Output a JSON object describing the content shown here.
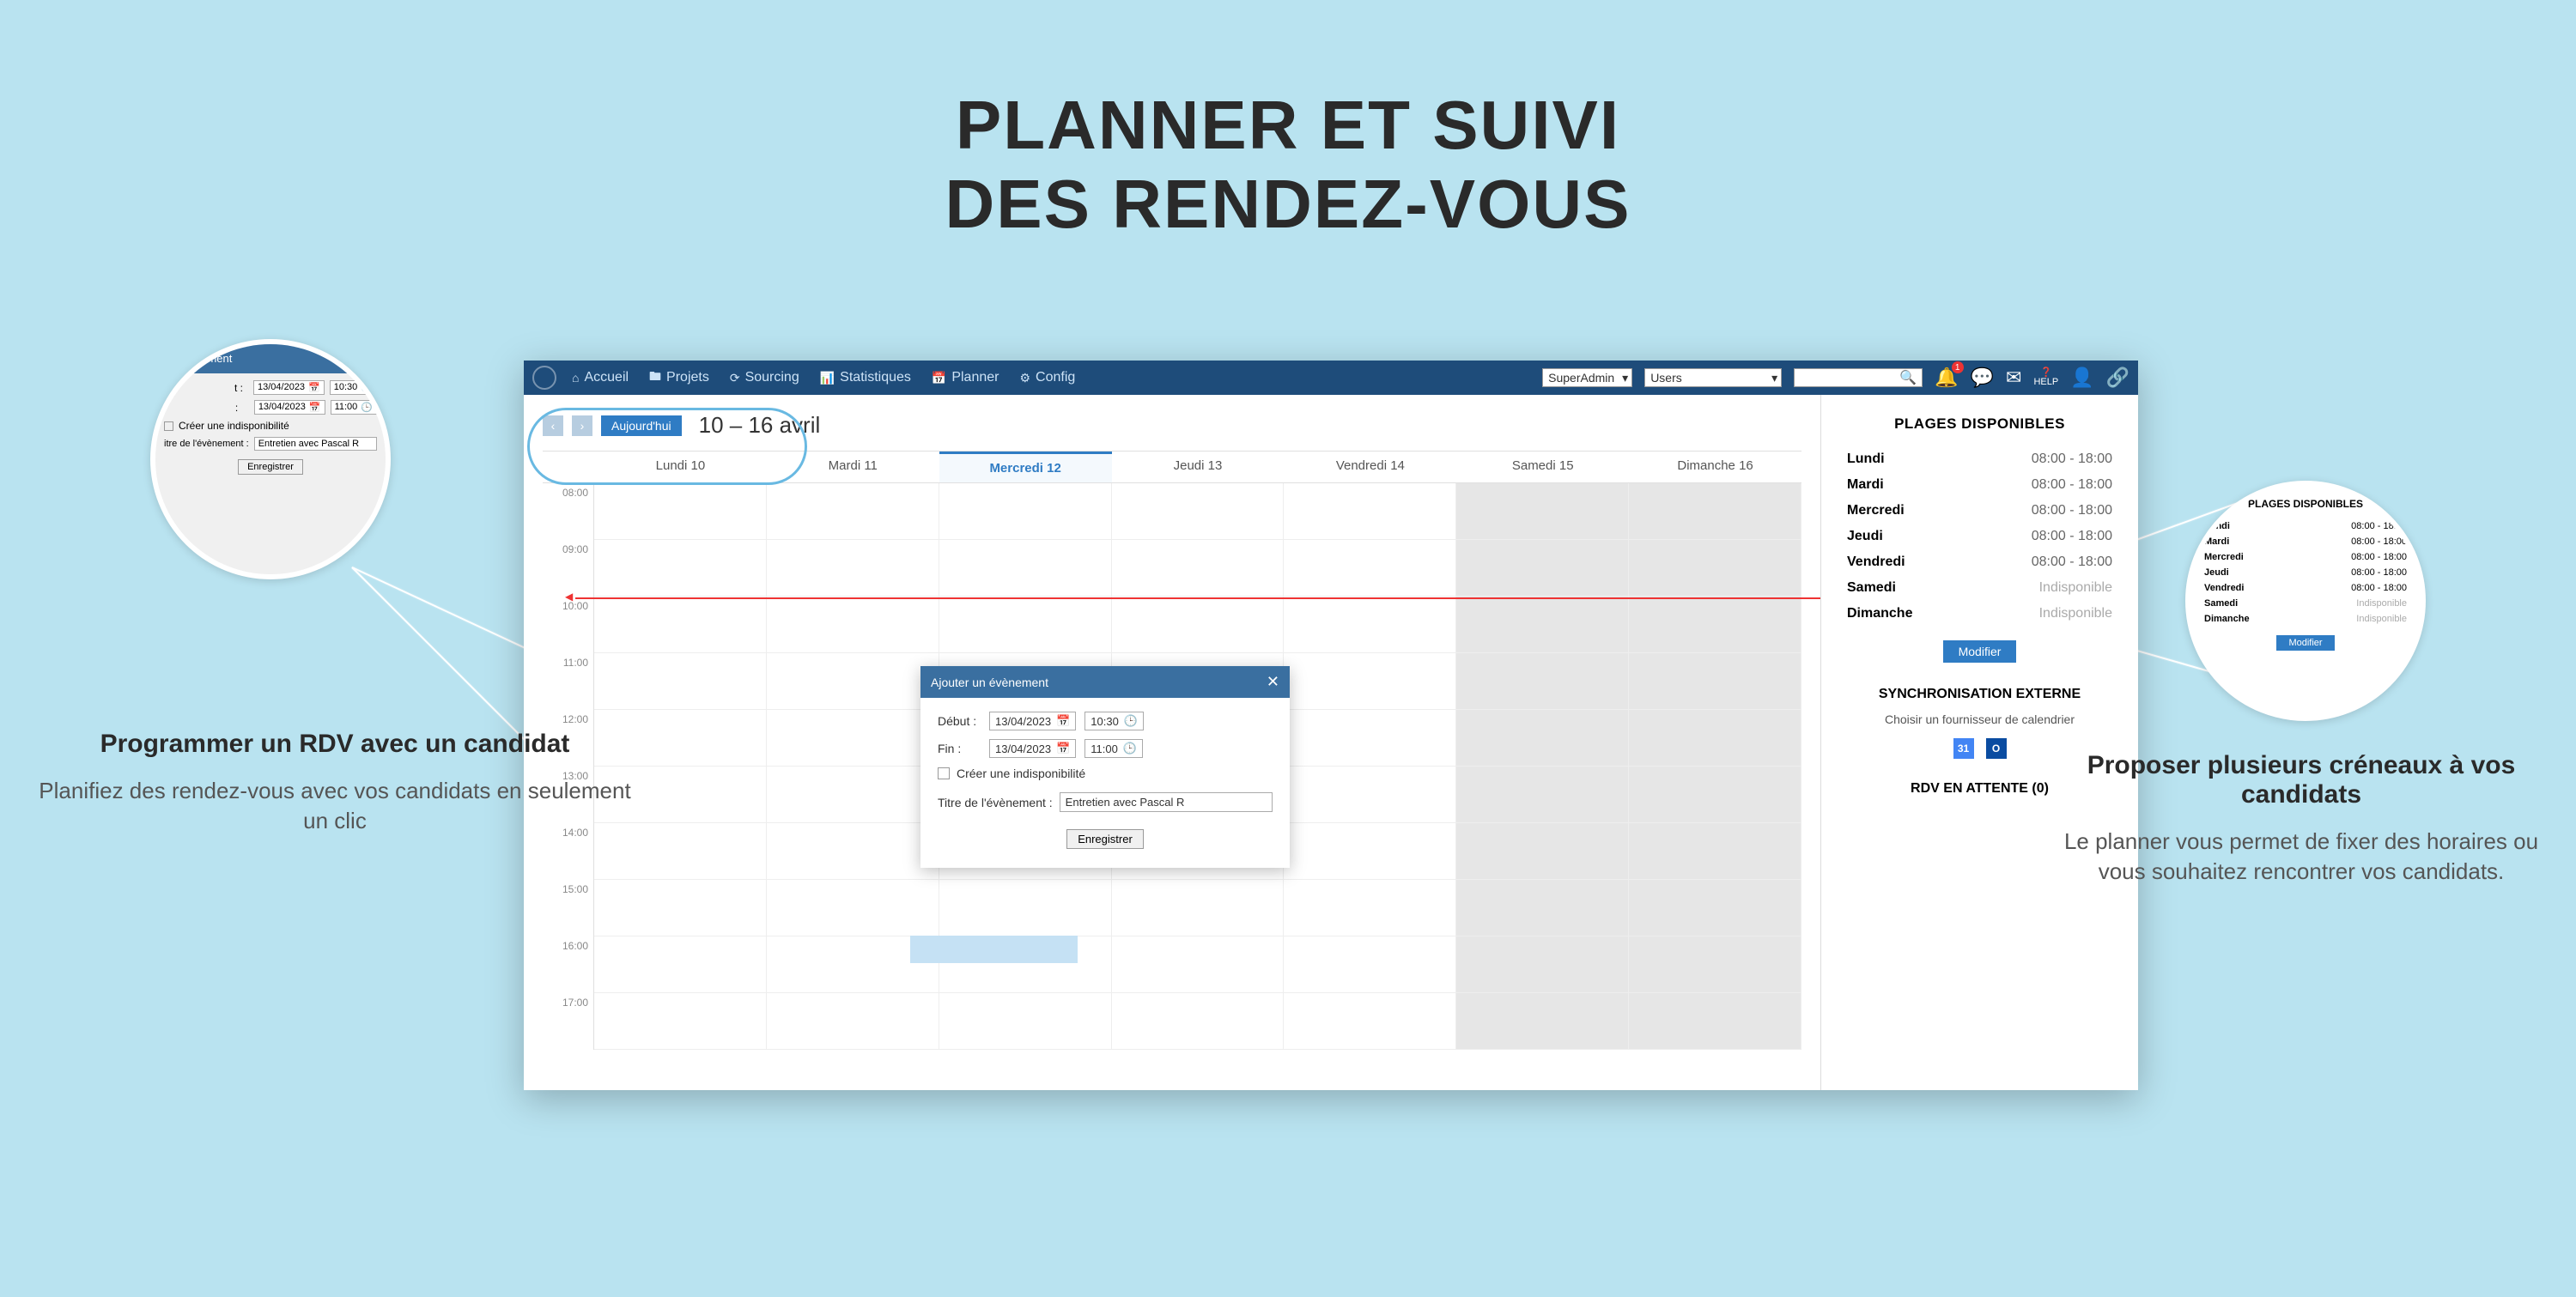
{
  "marketing": {
    "title_l1": "PLANNER ET SUIVI",
    "title_l2": "DES RENDEZ-VOUS"
  },
  "callout_left": {
    "title": "Programmer un RDV avec un candidat",
    "text": "Planifiez des rendez-vous avec vos candidats en seulement un clic"
  },
  "callout_right": {
    "title": "Proposer plusieurs créneaux à vos candidats",
    "text": "Le planner vous permet de fixer des horaires ou vous souhaitez rencontrer vos candidats."
  },
  "topbar": {
    "nav": [
      {
        "icon": "⌂",
        "label": "Accueil"
      },
      {
        "icon": "🖿",
        "label": "Projets"
      },
      {
        "icon": "⟳",
        "label": "Sourcing"
      },
      {
        "icon": "📊",
        "label": "Statistiques"
      },
      {
        "icon": "📅",
        "label": "Planner"
      },
      {
        "icon": "⚙",
        "label": "Config"
      }
    ],
    "select1": "SuperAdmin",
    "select2": "Users",
    "help_label": "HELP"
  },
  "calendar": {
    "today_btn": "Aujourd'hui",
    "range": "10 – 16 avril",
    "days": [
      "Lundi 10",
      "Mardi 11",
      "Mercredi 12",
      "Jeudi 13",
      "Vendredi 14",
      "Samedi 15",
      "Dimanche 16"
    ],
    "active_day": 2,
    "hours": [
      "08:00",
      "09:00",
      "10:00",
      "11:00",
      "12:00",
      "13:00",
      "14:00",
      "15:00",
      "16:00",
      "17:00"
    ]
  },
  "modal": {
    "title": "Ajouter un évènement",
    "label_start": "Début :",
    "label_end": "Fin :",
    "date_start": "13/04/2023",
    "time_start": "10:30",
    "date_end": "13/04/2023",
    "time_end": "11:00",
    "chk_label": "Créer une indisponibilité",
    "title_label": "Titre de l'évènement :",
    "title_value": "Entretien avec Pascal R",
    "save": "Enregistrer"
  },
  "sidebar": {
    "plages_title": "PLAGES DISPONIBLES",
    "plages": [
      {
        "day": "Lundi",
        "time": "08:00 - 18:00"
      },
      {
        "day": "Mardi",
        "time": "08:00 - 18:00"
      },
      {
        "day": "Mercredi",
        "time": "08:00 - 18:00"
      },
      {
        "day": "Jeudi",
        "time": "08:00 - 18:00"
      },
      {
        "day": "Vendredi",
        "time": "08:00 - 18:00"
      },
      {
        "day": "Samedi",
        "time": "Indisponible"
      },
      {
        "day": "Dimanche",
        "time": "Indisponible"
      }
    ],
    "modify": "Modifier",
    "sync_title": "SYNCHRONISATION EXTERNE",
    "sync_text": "Choisir un fournisseur de calendrier",
    "gcal": "31",
    "outlook": "O",
    "rdv_title": "RDV EN ATTENTE (0)"
  },
  "circles": {
    "right_title": "PLAGES DISPONIBLES",
    "label_nement": "nement"
  }
}
